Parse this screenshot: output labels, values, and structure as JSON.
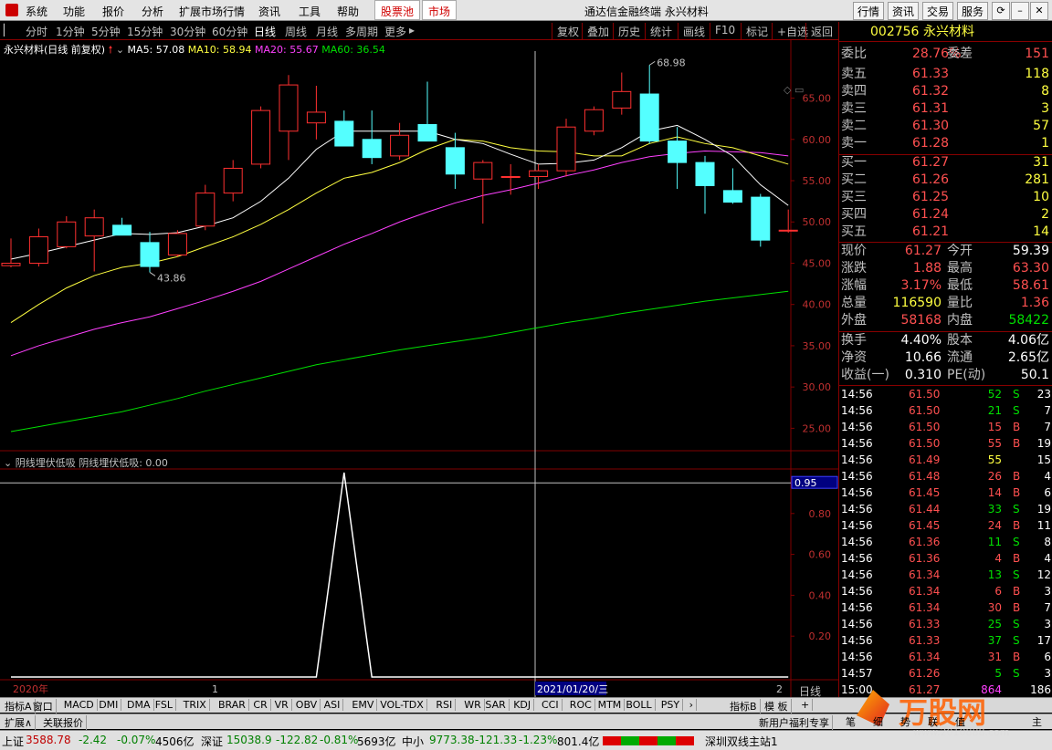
{
  "menu": {
    "items": [
      "系统",
      "功能",
      "报价",
      "分析",
      "扩展市场行情",
      "资讯",
      "工具",
      "帮助"
    ],
    "highlight1": "股票池",
    "highlight2": "市场",
    "title": "通达信金融终端  永兴材料",
    "right_buttons": [
      "行情",
      "资讯",
      "交易",
      "服务"
    ]
  },
  "periods": [
    "分时",
    "1分钟",
    "5分钟",
    "15分钟",
    "30分钟",
    "60分钟",
    "日线",
    "周线",
    "月线",
    "多周期",
    "更多"
  ],
  "active_period": "日线",
  "toolbar": [
    "复权",
    "叠加",
    "历史",
    "统计",
    "画线",
    "F10",
    "标记",
    "+自选",
    "返回"
  ],
  "legend": {
    "name": "永兴材料(日线 前复权)",
    "ma5": "MA5: 57.08",
    "ma10": "MA10: 58.94",
    "ma20": "MA20: 55.67",
    "ma60": "MA60: 36.54"
  },
  "indicator_title": "阴线埋伏低吸 阴线埋伏低吸: 0.00",
  "colors": {
    "up": "#ff3030",
    "down": "#54ffff",
    "ma5": "#ffffff",
    "ma10": "#ffff40",
    "ma20": "#ff40ff",
    "ma60": "#00e000",
    "grid": "#800000"
  },
  "chart_data": {
    "type": "candlestick",
    "title": "永兴材料(日线 前复权)",
    "price_axis_ticks": [
      65.0,
      60.0,
      55.0,
      50.0,
      45.0,
      40.0,
      35.0,
      30.0,
      25.0
    ],
    "price_range": [
      22.5,
      70.7
    ],
    "indicator_axis_ticks": [
      0.95,
      0.8,
      0.6,
      0.4,
      0.2
    ],
    "indicator_range": [
      0,
      1
    ],
    "annotations": {
      "high": "68.98",
      "low": "43.86"
    },
    "candles": [
      {
        "o": 44.7,
        "h": 48.0,
        "l": 44.5,
        "c": 45.0
      },
      {
        "o": 45.0,
        "h": 49.2,
        "l": 44.6,
        "c": 48.2
      },
      {
        "o": 47.0,
        "h": 50.7,
        "l": 46.8,
        "c": 50.0
      },
      {
        "o": 48.3,
        "h": 51.5,
        "l": 44.0,
        "c": 50.5
      },
      {
        "o": 49.6,
        "h": 50.5,
        "l": 48.5,
        "c": 48.4
      },
      {
        "o": 47.5,
        "h": 48.8,
        "l": 43.9,
        "c": 44.6
      },
      {
        "o": 46.0,
        "h": 49.0,
        "l": 45.8,
        "c": 48.6
      },
      {
        "o": 49.5,
        "h": 54.5,
        "l": 49.0,
        "c": 53.5
      },
      {
        "o": 53.5,
        "h": 57.5,
        "l": 52.5,
        "c": 56.5
      },
      {
        "o": 57.0,
        "h": 64.0,
        "l": 56.5,
        "c": 63.5
      },
      {
        "o": 61.0,
        "h": 67.8,
        "l": 57.5,
        "c": 66.6
      },
      {
        "o": 62.0,
        "h": 66.5,
        "l": 60.0,
        "c": 63.3
      },
      {
        "o": 62.2,
        "h": 63.5,
        "l": 59.5,
        "c": 59.2
      },
      {
        "o": 60.0,
        "h": 63.5,
        "l": 57.0,
        "c": 57.8
      },
      {
        "o": 58.0,
        "h": 62.0,
        "l": 57.5,
        "c": 60.5
      },
      {
        "o": 61.8,
        "h": 67.0,
        "l": 60.0,
        "c": 59.8
      },
      {
        "o": 59.0,
        "h": 60.8,
        "l": 54.0,
        "c": 55.8
      },
      {
        "o": 55.2,
        "h": 57.5,
        "l": 49.8,
        "c": 57.2
      },
      {
        "o": 55.4,
        "h": 57.0,
        "l": 53.3,
        "c": 55.5
      },
      {
        "o": 55.5,
        "h": 57.0,
        "l": 54.0,
        "c": 56.2
      },
      {
        "o": 56.2,
        "h": 62.5,
        "l": 55.5,
        "c": 61.5
      },
      {
        "o": 61.0,
        "h": 64.0,
        "l": 60.5,
        "c": 63.6
      },
      {
        "o": 63.8,
        "h": 68.1,
        "l": 63.0,
        "c": 65.8
      },
      {
        "o": 65.5,
        "h": 69.0,
        "l": 59.5,
        "c": 59.8
      },
      {
        "o": 59.8,
        "h": 61.5,
        "l": 54.0,
        "c": 57.2
      },
      {
        "o": 57.2,
        "h": 58.0,
        "l": 51.0,
        "c": 54.4
      },
      {
        "o": 53.8,
        "h": 56.5,
        "l": 52.2,
        "c": 52.4
      },
      {
        "o": 53.0,
        "h": 53.4,
        "l": 47.0,
        "c": 47.8
      },
      {
        "o": 49.0,
        "h": 51.5,
        "l": 48.7,
        "c": 49.0
      }
    ],
    "ma5": [
      45.5,
      46.2,
      47.0,
      47.8,
      48.6,
      48.5,
      48.7,
      49.5,
      50.5,
      52.5,
      55.3,
      58.8,
      61.0,
      61.0,
      61.0,
      61.0,
      60.0,
      59.5,
      58.2,
      57.0,
      57.1,
      57.5,
      59.0,
      61.0,
      61.7,
      60.0,
      58.0,
      54.5,
      52.0
    ],
    "ma10": [
      37.8,
      40.0,
      42.0,
      43.5,
      44.5,
      45.0,
      45.8,
      47.0,
      48.2,
      49.7,
      51.5,
      53.5,
      55.3,
      56.0,
      57.2,
      58.8,
      60.0,
      59.8,
      59.0,
      58.6,
      58.5,
      58.0,
      58.0,
      59.5,
      60.3,
      59.5,
      59.0,
      58.0,
      57.0
    ],
    "ma20": [
      33.8,
      35.0,
      36.0,
      37.0,
      37.8,
      38.5,
      39.5,
      40.5,
      41.6,
      42.8,
      44.3,
      45.8,
      47.3,
      48.6,
      50.0,
      51.2,
      52.3,
      53.2,
      53.9,
      54.7,
      55.6,
      56.3,
      57.2,
      57.9,
      58.3,
      58.6,
      58.5,
      58.4,
      58.0
    ],
    "ma60": [
      24.6,
      25.2,
      25.8,
      26.4,
      27.0,
      27.8,
      28.6,
      29.5,
      30.3,
      31.1,
      31.9,
      32.7,
      33.3,
      33.9,
      34.5,
      35.0,
      35.5,
      36.0,
      36.6,
      37.2,
      37.8,
      38.3,
      38.9,
      39.4,
      39.9,
      40.4,
      40.8,
      41.2,
      41.6
    ],
    "indicator": [
      0,
      0,
      0,
      0,
      0,
      0,
      0,
      0,
      0,
      0,
      0,
      0,
      1,
      0,
      0,
      0,
      0,
      0,
      0,
      0,
      0,
      0,
      0,
      0,
      0,
      0,
      0,
      0,
      0
    ],
    "x_labels": [
      "2020年",
      "1",
      "2021/01/20/三",
      "2"
    ]
  },
  "quote": {
    "code": "002756",
    "name": "永兴材料",
    "weibi_label": "委比",
    "weibi": "28.76%",
    "weicha_label": "委差",
    "weicha": "151",
    "asks": [
      {
        "label": "卖五",
        "price": "61.33",
        "vol": "118"
      },
      {
        "label": "卖四",
        "price": "61.32",
        "vol": "8"
      },
      {
        "label": "卖三",
        "price": "61.31",
        "vol": "3"
      },
      {
        "label": "卖二",
        "price": "61.30",
        "vol": "57"
      },
      {
        "label": "卖一",
        "price": "61.28",
        "vol": "1"
      }
    ],
    "bids": [
      {
        "label": "买一",
        "price": "61.27",
        "vol": "31"
      },
      {
        "label": "买二",
        "price": "61.26",
        "vol": "281"
      },
      {
        "label": "买三",
        "price": "61.25",
        "vol": "10"
      },
      {
        "label": "买四",
        "price": "61.24",
        "vol": "2"
      },
      {
        "label": "买五",
        "price": "61.21",
        "vol": "14"
      }
    ],
    "stats": [
      {
        "l1": "现价",
        "v1": "61.27",
        "c1": "red",
        "l2": "今开",
        "v2": "59.39",
        "c2": "white"
      },
      {
        "l1": "涨跌",
        "v1": "1.88",
        "c1": "red",
        "l2": "最高",
        "v2": "63.30",
        "c2": "red"
      },
      {
        "l1": "涨幅",
        "v1": "3.17%",
        "c1": "red",
        "l2": "最低",
        "v2": "58.61",
        "c2": "red"
      },
      {
        "l1": "总量",
        "v1": "116590",
        "c1": "yellow",
        "l2": "量比",
        "v2": "1.36",
        "c2": "red"
      },
      {
        "l1": "外盘",
        "v1": "58168",
        "c1": "red",
        "l2": "内盘",
        "v2": "58422",
        "c2": "green"
      },
      {
        "l1": "换手",
        "v1": "4.40%",
        "c1": "white",
        "l2": "股本",
        "v2": "4.06亿",
        "c2": "white"
      },
      {
        "l1": "净资",
        "v1": "10.66",
        "c1": "white",
        "l2": "流通",
        "v2": "2.65亿",
        "c2": "white"
      },
      {
        "l1": "收益(一)",
        "v1": "0.310",
        "c1": "white",
        "l2": "PE(动)",
        "v2": "50.1",
        "c2": "white"
      }
    ]
  },
  "ticks": [
    {
      "t": "14:56",
      "p": "61.50",
      "v": "52",
      "d": "S",
      "n": "23"
    },
    {
      "t": "14:56",
      "p": "61.50",
      "v": "21",
      "d": "S",
      "n": "7"
    },
    {
      "t": "14:56",
      "p": "61.50",
      "v": "15",
      "d": "B",
      "n": "7"
    },
    {
      "t": "14:56",
      "p": "61.50",
      "v": "55",
      "d": "B",
      "n": "19"
    },
    {
      "t": "14:56",
      "p": "61.49",
      "v": "55",
      "d": "",
      "n": "15"
    },
    {
      "t": "14:56",
      "p": "61.48",
      "v": "26",
      "d": "B",
      "n": "4"
    },
    {
      "t": "14:56",
      "p": "61.45",
      "v": "14",
      "d": "B",
      "n": "6"
    },
    {
      "t": "14:56",
      "p": "61.44",
      "v": "33",
      "d": "S",
      "n": "19"
    },
    {
      "t": "14:56",
      "p": "61.45",
      "v": "24",
      "d": "B",
      "n": "11"
    },
    {
      "t": "14:56",
      "p": "61.36",
      "v": "11",
      "d": "S",
      "n": "8"
    },
    {
      "t": "14:56",
      "p": "61.36",
      "v": "4",
      "d": "B",
      "n": "4"
    },
    {
      "t": "14:56",
      "p": "61.34",
      "v": "13",
      "d": "S",
      "n": "12"
    },
    {
      "t": "14:56",
      "p": "61.34",
      "v": "6",
      "d": "B",
      "n": "3"
    },
    {
      "t": "14:56",
      "p": "61.34",
      "v": "30",
      "d": "B",
      "n": "7"
    },
    {
      "t": "14:56",
      "p": "61.33",
      "v": "25",
      "d": "S",
      "n": "3"
    },
    {
      "t": "14:56",
      "p": "61.33",
      "v": "37",
      "d": "S",
      "n": "17"
    },
    {
      "t": "14:56",
      "p": "61.34",
      "v": "31",
      "d": "B",
      "n": "6"
    },
    {
      "t": "14:57",
      "p": "61.26",
      "v": "5",
      "d": "S",
      "n": "3"
    },
    {
      "t": "15:00",
      "p": "61.27",
      "v": "864",
      "d": "",
      "n": "186"
    }
  ],
  "x_period_label": "日线",
  "indicator_tabs": [
    "指标A",
    "窗口",
    "MACD",
    "DMI",
    "DMA",
    "FSL",
    "TRIX",
    "BRAR",
    "CR",
    "VR",
    "OBV",
    "ASI",
    "EMV",
    "VOL-TDX",
    "RSI",
    "WR",
    "SAR",
    "KDJ",
    "CCI",
    "ROC",
    "MTM",
    "BOLL",
    "PSY"
  ],
  "indicator_right": [
    "指标B",
    "模 板",
    "+"
  ],
  "ext_tabs": [
    "扩展∧",
    "关联报价"
  ],
  "ext_right": "新用户福利专享",
  "status": {
    "sh_label": "上证",
    "sh": "3588.78",
    "sh_chg": "-2.42",
    "sh_pct": "-0.07%",
    "sh_amt": "4506亿",
    "sz_label": "深证",
    "sz": "15038.9",
    "sz_chg": "-122.82",
    "sz_pct": "-0.81%",
    "sz_amt": "5693亿",
    "zx_label": "中小",
    "zx": "9773.38",
    "zx_chg": "-121.33",
    "zx_pct": "-1.23%",
    "zx_amt": "801.4亿",
    "news": "深圳双线主站1"
  },
  "watermark": {
    "text": "万股网",
    "url": "www.2010888.com"
  },
  "bottom_tabs": [
    "笔",
    "细",
    "势",
    "联",
    "值",
    "主"
  ]
}
